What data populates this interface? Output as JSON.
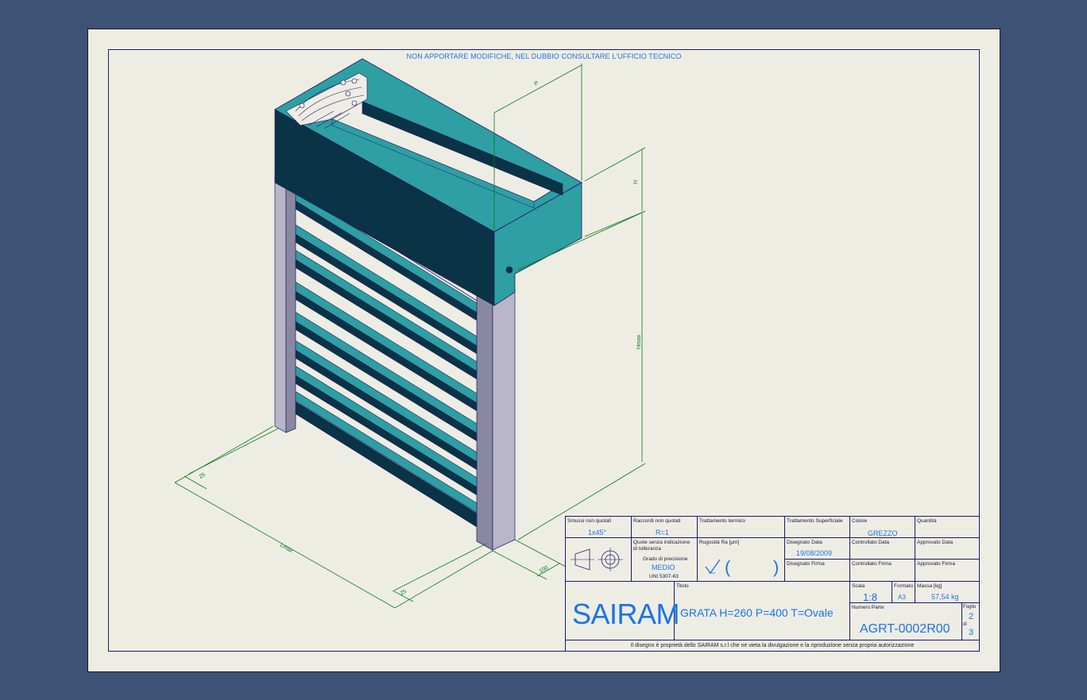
{
  "note": "NON APPORTARE MODIFICHE, NEL DUBBIO CONSULTARE L'UFFICIO TECNICO",
  "dimensions": {
    "depth": "P",
    "box_height": "H",
    "height": "Hmax",
    "width": "Lmax",
    "left_edge": "25",
    "right_edge": "25",
    "post": "100"
  },
  "title_block": {
    "smussi_label": "Smussi non quotati",
    "smussi_value": "1x45°",
    "raccordi_label": "Raccordi non quotati",
    "raccordi_value": "R=1",
    "trattamento_termico_label": "Trattamento termico",
    "trattamento_superficiale_label": "Trattamento Superficiale",
    "colore_label": "Colore",
    "colore_value": "GREZZO",
    "quantita_label": "Quantità",
    "quote_label": "Quote senza indicazione di tolleranza",
    "grado_label": "Grado di precisione",
    "grado_value": "MEDIO",
    "norma_value": "UNI 5307-63",
    "rugosita_label": "Rugosità Ra [µm]",
    "rugosita_open": "(",
    "rugosita_close": ")",
    "disegnato_data_label": "Disegnato Data",
    "disegnato_data_value": "19/08/2009",
    "disegnato_firma_label": "Disegnato Firma",
    "controllato_data_label": "Controllato Data",
    "controllato_firma_label": "Controllato Firma",
    "approvato_data_label": "Approvato Data",
    "approvato_firma_label": "Approvato Firma",
    "company": "SAIRAM",
    "titolo_label": "Titolo",
    "titolo_value": "GRATA H=260 P=400 T=Ovale",
    "scala_label": "Scala",
    "scala_value": "1:8",
    "formato_label": "Formato",
    "formato_value": "A3",
    "massa_label": "Massa [kg]",
    "massa_value": "57,54 kg",
    "numero_parte_label": "Numero Parte",
    "numero_parte_value": "AGRT-0002R00",
    "foglio_label": "Foglio",
    "foglio_num": "2",
    "foglio_di": "di",
    "foglio_tot": "3",
    "footer": "Il disegno è proprietà dello SAIRAM s.r.l che ne vieta la divulgazione e la riproduzione senza propria autorizzazione"
  },
  "colors": {
    "teal_light": "#2e9fa3",
    "teal_dark": "#0a3346",
    "post_light": "#b8b6c8",
    "dimension_green": "#0a7a1a",
    "value_blue": "#1a73e8"
  }
}
